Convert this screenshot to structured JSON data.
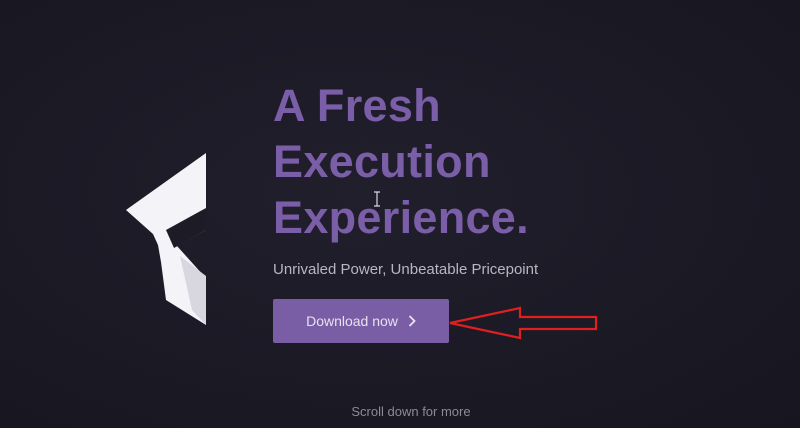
{
  "hero": {
    "headline": [
      "A Fresh",
      "Execution",
      "Experience."
    ],
    "subtitle": "Unrivaled Power, Unbeatable Pricepoint",
    "download_label": "Download now",
    "scroll_hint": "Scroll down for more"
  },
  "icons": {
    "logo": "f-logo-icon",
    "button_chevron": "chevron-right-icon",
    "cursor": "text-cursor-icon",
    "annotation": "red-arrow-annotation-icon"
  },
  "colors": {
    "background": "#1c1a26",
    "accent": "#7a5ea5",
    "headline": "#7b5ea8",
    "subtitle": "#b9b6c3",
    "annotation": "#e0201f"
  }
}
